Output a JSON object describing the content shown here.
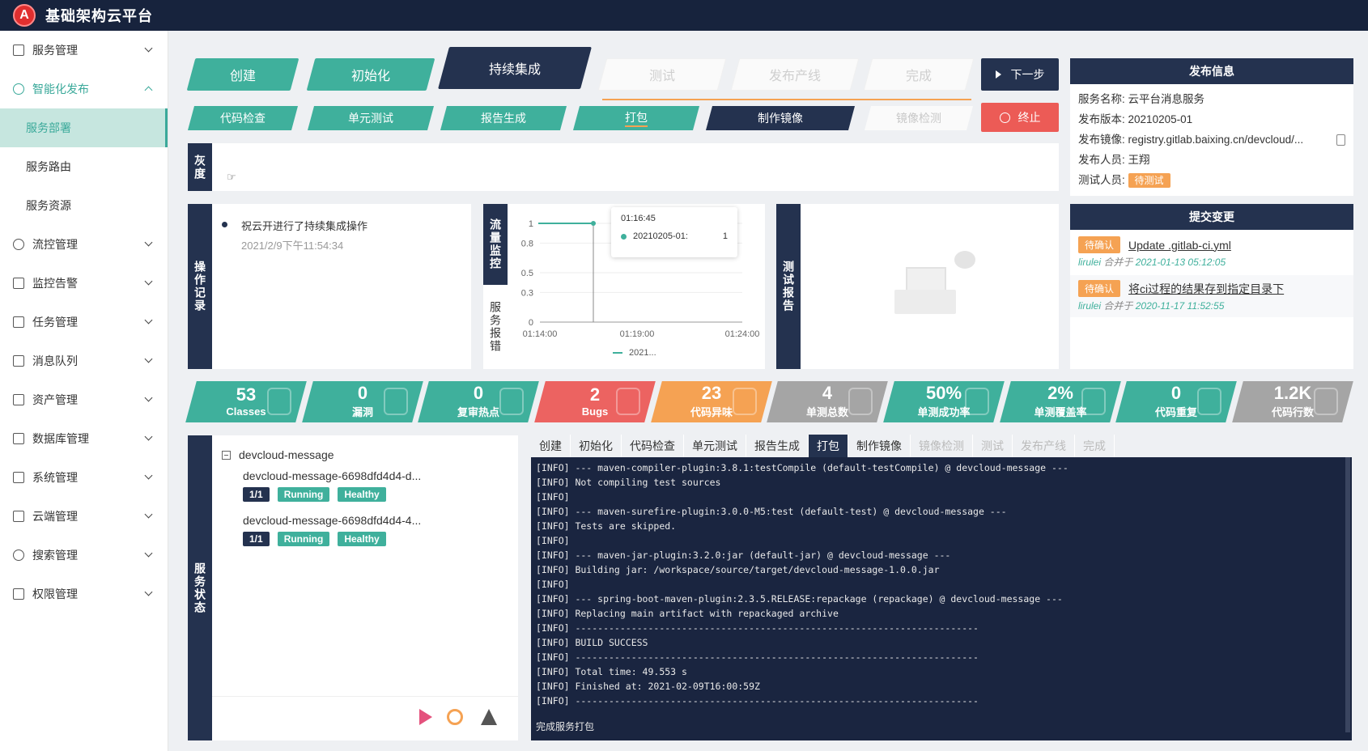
{
  "app": {
    "title": "基础架构云平台",
    "logo": "A"
  },
  "sidebar": {
    "items": [
      {
        "label": "服务管理",
        "icon": "grid-icon"
      },
      {
        "label": "智能化发布",
        "icon": "rocket-icon",
        "open": true
      },
      {
        "label": "流控管理",
        "icon": "flow-icon"
      },
      {
        "label": "监控告警",
        "icon": "alarm-icon"
      },
      {
        "label": "任务管理",
        "icon": "calendar-icon"
      },
      {
        "label": "消息队列",
        "icon": "mail-icon"
      },
      {
        "label": "资产管理",
        "icon": "wrench-icon"
      },
      {
        "label": "数据库管理",
        "icon": "database-icon"
      },
      {
        "label": "系统管理",
        "icon": "home-icon"
      },
      {
        "label": "云端管理",
        "icon": "cloud-icon"
      },
      {
        "label": "搜索管理",
        "icon": "search-icon"
      },
      {
        "label": "权限管理",
        "icon": "home-icon"
      }
    ],
    "subitems": [
      "服务部署",
      "服务路由",
      "服务资源"
    ]
  },
  "pipeline": {
    "steps": [
      "创建",
      "初始化",
      "持续集成",
      "测试",
      "发布产线",
      "完成"
    ],
    "substeps": [
      "代码检查",
      "单元测试",
      "报告生成",
      "打包",
      "制作镜像",
      "镜像检测"
    ],
    "next": "下一步",
    "stop": "终止"
  },
  "gray": {
    "label": "灰度"
  },
  "record": {
    "label": "操作记录",
    "text": "祝云开进行了持续集成操作",
    "time": "2021/2/9下午11:54:34"
  },
  "flow": {
    "label": "流量监控",
    "label2": "服务报错",
    "tooltip_time": "01:16:45",
    "tooltip_series": "20210205-01:",
    "tooltip_value": "1",
    "legend": "2021..."
  },
  "chart_data": {
    "type": "line",
    "x": [
      "01:14:00",
      "01:16:45",
      "01:19:00",
      "01:24:00"
    ],
    "series": [
      {
        "name": "20210205-01",
        "values": [
          1,
          1,
          null,
          null
        ]
      }
    ],
    "yticks": [
      "1",
      "0.8",
      "0.5",
      "0.3",
      "0"
    ],
    "xticks": [
      "01:14:00",
      "01:19:00",
      "01:24:00"
    ],
    "ylim": [
      0,
      1
    ]
  },
  "test_report": {
    "label": "测试报告"
  },
  "release": {
    "head": "发布信息",
    "rows": [
      {
        "k": "服务名称:",
        "v": "云平台消息服务"
      },
      {
        "k": "发布版本:",
        "v": "20210205-01"
      },
      {
        "k": "发布镜像:",
        "v": "registry.gitlab.baixing.cn/devcloud/..."
      },
      {
        "k": "发布人员:",
        "v": "王翔"
      },
      {
        "k": "测试人员:",
        "v": "待测试"
      }
    ]
  },
  "changes": {
    "head": "提交变更",
    "items": [
      {
        "tag": "待确认",
        "title": "Update .gitlab-ci.yml",
        "author": "lirulei",
        "verb": "合并于",
        "date": "2021-01-13 05:12:05"
      },
      {
        "tag": "待确认",
        "title": "将ci过程的结果存到指定目录下",
        "author": "lirulei",
        "verb": "合并于",
        "date": "2020-11-17 11:52:55"
      }
    ]
  },
  "metrics": [
    {
      "num": "53",
      "lab": "Classes",
      "color": "#3fb09c"
    },
    {
      "num": "0",
      "lab": "漏洞",
      "color": "#3fb09c"
    },
    {
      "num": "0",
      "lab": "复审热点",
      "color": "#3fb09c"
    },
    {
      "num": "2",
      "lab": "Bugs",
      "color": "#ec6361"
    },
    {
      "num": "23",
      "lab": "代码异味",
      "color": "#f5a253"
    },
    {
      "num": "4",
      "lab": "单测总数",
      "color": "#a5a5a5"
    },
    {
      "num": "50%",
      "lab": "单测成功率",
      "color": "#3fb09c"
    },
    {
      "num": "2%",
      "lab": "单测覆盖率",
      "color": "#3fb09c"
    },
    {
      "num": "0",
      "lab": "代码重复",
      "color": "#3fb09c"
    },
    {
      "num": "1.2K",
      "lab": "代码行数",
      "color": "#a5a5a5"
    }
  ],
  "service": {
    "label": "服务状态",
    "root": "devcloud-message",
    "pods": [
      {
        "name": "devcloud-message-6698dfd4d4-d...",
        "ready": "1/1",
        "status": "Running",
        "health": "Healthy"
      },
      {
        "name": "devcloud-message-6698dfd4d4-4...",
        "ready": "1/1",
        "status": "Running",
        "health": "Healthy"
      }
    ]
  },
  "logtabs": [
    "创建",
    "初始化",
    "代码检查",
    "单元测试",
    "报告生成",
    "打包",
    "制作镜像",
    "镜像检测",
    "测试",
    "发布产线",
    "完成"
  ],
  "log": {
    "lines": [
      "[INFO] --- maven-compiler-plugin:3.8.1:testCompile (default-testCompile) @ devcloud-message ---",
      "[INFO] Not compiling test sources",
      "[INFO]",
      "[INFO] --- maven-surefire-plugin:3.0.0-M5:test (default-test) @ devcloud-message ---",
      "[INFO] Tests are skipped.",
      "[INFO]",
      "[INFO] --- maven-jar-plugin:3.2.0:jar (default-jar) @ devcloud-message ---",
      "[INFO] Building jar: /workspace/source/target/devcloud-message-1.0.0.jar",
      "[INFO]",
      "[INFO] --- spring-boot-maven-plugin:2.3.5.RELEASE:repackage (repackage) @ devcloud-message ---",
      "[INFO] Replacing main artifact with repackaged archive",
      "[INFO] ------------------------------------------------------------------------",
      "[INFO] BUILD SUCCESS",
      "[INFO] ------------------------------------------------------------------------",
      "[INFO] Total time: 49.553 s",
      "[INFO] Finished at: 2021-02-09T16:00:59Z",
      "[INFO] ------------------------------------------------------------------------"
    ],
    "footer": "完成服务打包"
  }
}
